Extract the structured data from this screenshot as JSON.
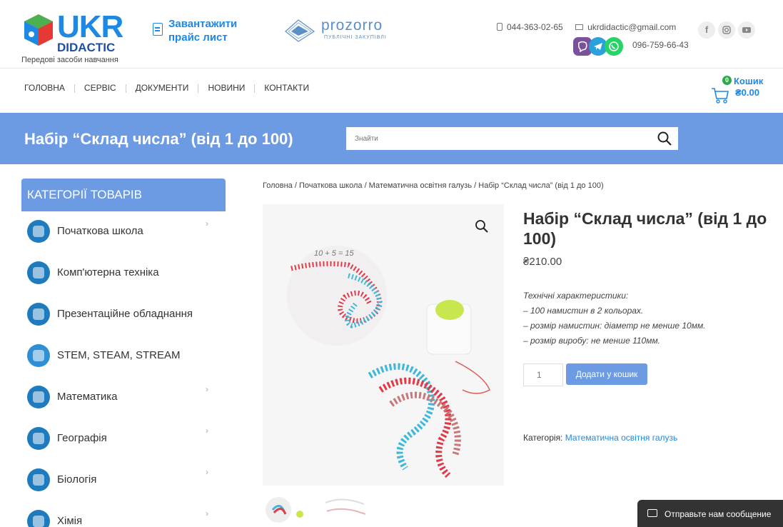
{
  "header": {
    "logo": {
      "big": "UKR",
      "small": "DIDACTIC",
      "tagline": "Передові засоби навчання"
    },
    "price_download": "Завантажити прайс лист",
    "prozorro": {
      "name": "prozorro",
      "sub": "ПУБЛІЧНІ ЗАКУПІВЛІ"
    },
    "phone": "044-363-02-65",
    "email": "ukrdidactic@gmail.com",
    "phone2": "096-759-66-43",
    "socials": [
      "facebook-icon",
      "instagram-icon",
      "youtube-icon"
    ],
    "messengers": [
      "viber-icon",
      "telegram-icon",
      "whatsapp-icon"
    ]
  },
  "nav": {
    "items": [
      "ГОЛОВНА",
      "СЕРВІС",
      "ДОКУМЕНТИ",
      "НОВИНИ",
      "КОНТАКТИ"
    ]
  },
  "cart": {
    "count": "0",
    "label": "Кошик",
    "total": "₴0.00"
  },
  "band": {
    "title": "Набір “Склад числа” (від 1 до 100)"
  },
  "search": {
    "placeholder": "Знайти"
  },
  "sidebar": {
    "heading": "КАТЕГОРІЇ ТОВАРІВ",
    "items": [
      {
        "label": "Початкова школа",
        "has_sub": true,
        "color": "#1e7bbd"
      },
      {
        "label": "Комп'ютерна техніка",
        "has_sub": false,
        "color": "#1e7bbd"
      },
      {
        "label": "Презентаційне обладнання",
        "has_sub": false,
        "color": "#1e7bbd"
      },
      {
        "label": "STEM, STEAM, STREAM",
        "has_sub": false,
        "color": "#2f8fd4"
      },
      {
        "label": "Математика",
        "has_sub": true,
        "color": "#1e7bbd"
      },
      {
        "label": "Географія",
        "has_sub": true,
        "color": "#1e7bbd"
      },
      {
        "label": "Біологія",
        "has_sub": true,
        "color": "#1e7bbd"
      },
      {
        "label": "Хімія",
        "has_sub": true,
        "color": "#1e7bbd"
      }
    ]
  },
  "breadcrumb": "Головна / Початкова школа / Математична освітня галузь / Набір “Склад числа” (від 1 до 100)",
  "product": {
    "title": "Набір “Склад числа” (від 1 до 100)",
    "price": "₴210.00",
    "specs": [
      "Технічні характеристики:",
      "– 100 намистин в 2 кольорах.",
      "– розмір намистин: діаметр не менше 10мм.",
      "– розмір виробу: не менше 110мм."
    ],
    "qty": "1",
    "add_to_cart": "Додати у кошик",
    "category_label": "Категорія:",
    "category_value": "Математична освітня галузь",
    "image_caption": "10 + 5 = 15"
  },
  "chat": {
    "label": "Отправьте нам сообщение"
  },
  "colors": {
    "accent": "#6c9be4",
    "link": "#1e88e5",
    "bead_red": "#e03a48",
    "bead_blue": "#3cb8d8"
  }
}
